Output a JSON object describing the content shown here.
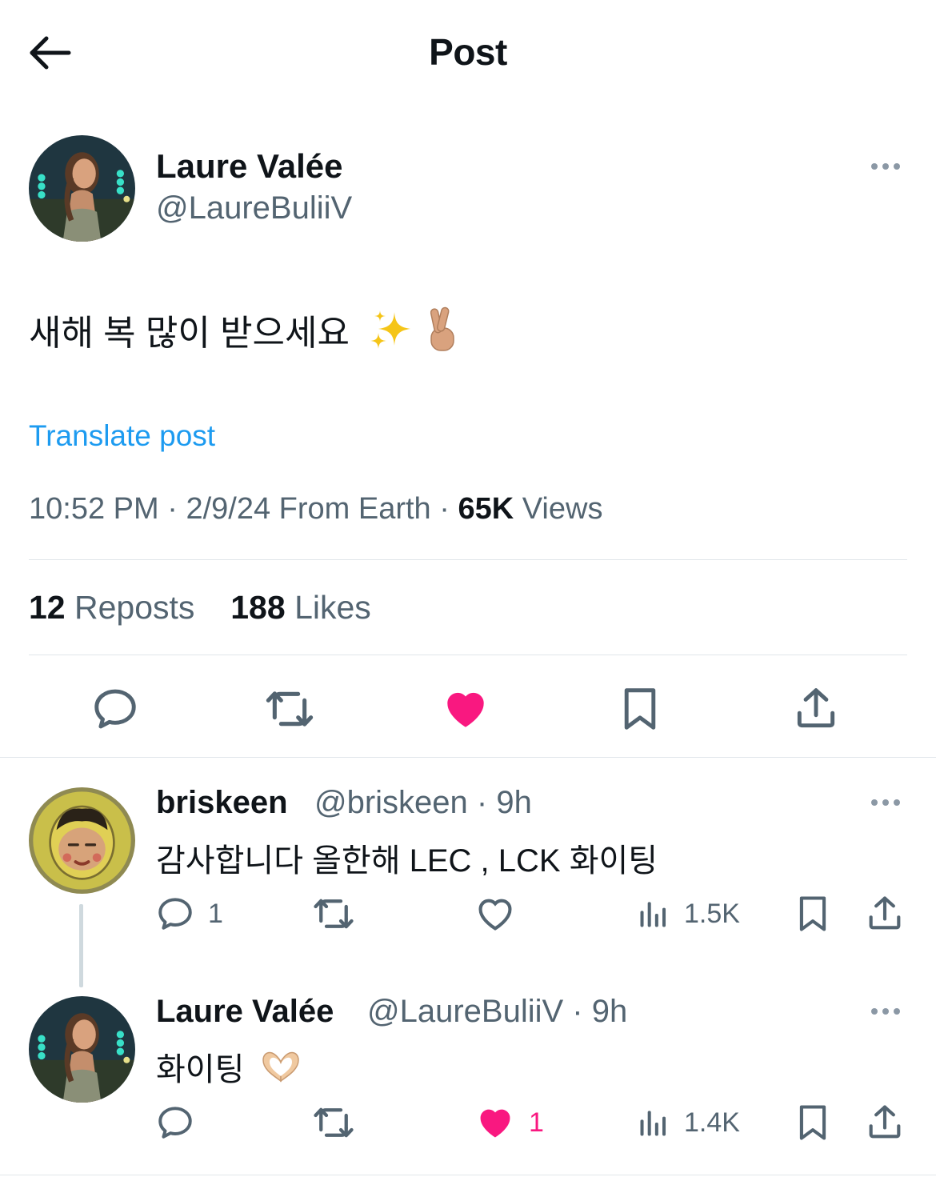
{
  "header": {
    "title": "Post"
  },
  "post": {
    "name": "Laure Valée",
    "handle": "@LaureBuliiV",
    "text": "새해 복 많이 받으세요",
    "translate": "Translate post",
    "time": "10:52 PM",
    "date": "2/9/24",
    "source": "From Earth",
    "views_count": "65K",
    "views_label": "Views",
    "reposts_count": "12",
    "reposts_label": "Reposts",
    "likes_count": "188",
    "likes_label": "Likes",
    "liked": true,
    "like_color": "#f91880"
  },
  "replies": [
    {
      "name": "briskeen",
      "handle": "@briskeen",
      "age": "9h",
      "text": "감사합니다 올한해 LEC , LCK 화이팅",
      "reply_count": "1",
      "repost_count": "",
      "like_count": "",
      "liked": false,
      "views": "1.5K"
    },
    {
      "name": "Laure Valée",
      "handle": "@LaureBuliiV",
      "age": "9h",
      "text": "화이팅",
      "reply_count": "",
      "repost_count": "",
      "like_count": "1",
      "liked": true,
      "views": "1.4K"
    }
  ],
  "icons": [
    "back-arrow-icon",
    "more-icon",
    "reply-icon",
    "repost-icon",
    "like-icon",
    "bookmark-icon",
    "share-icon",
    "views-icon",
    "sparkles-emoji",
    "crossed-fingers-emoji",
    "heart-hands-emoji"
  ],
  "colors": {
    "link": "#1d9bf0",
    "like": "#f91880",
    "muted": "#536471",
    "text": "#0f1419"
  }
}
